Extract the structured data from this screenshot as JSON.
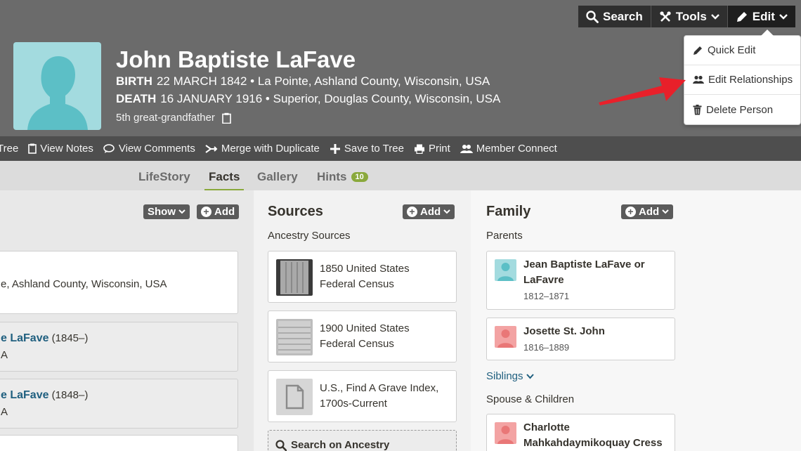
{
  "profile": {
    "name": "John Baptiste LaFave",
    "birth_label": "BIRTH",
    "birth_value": "22 MARCH 1842 • La Pointe, Ashland County, Wisconsin, USA",
    "death_label": "DEATH",
    "death_value": "16 JANUARY 1916 • Superior, Douglas County, Wisconsin, USA",
    "relationship": "5th great-grandfather"
  },
  "top_buttons": {
    "search": "Search",
    "tools": "Tools",
    "edit": "Edit"
  },
  "edit_menu": {
    "quick_edit": "Quick Edit",
    "edit_relationships": "Edit Relationships",
    "delete_person": "Delete Person"
  },
  "action_bar": {
    "tree": "Tree",
    "view_notes": "View Notes",
    "view_comments": "View Comments",
    "merge": "Merge with Duplicate",
    "save": "Save to Tree",
    "print": "Print",
    "member_connect": "Member Connect"
  },
  "tabs": {
    "lifestory": "LifeStory",
    "facts": "Facts",
    "gallery": "Gallery",
    "hints": "Hints",
    "hints_count": "10"
  },
  "facts": {
    "show_label": "Show",
    "add_label": "Add",
    "fact1_place": "e, Ashland County, Wisconsin, USA",
    "sib1_name": "e LaFave",
    "sib1_years": "(1845–)",
    "sib1_sub": "A",
    "sib2_name": "e LaFave",
    "sib2_years": "(1848–)",
    "sib2_sub": "A"
  },
  "sources": {
    "title": "Sources",
    "add_label": "Add",
    "subtitle": "Ancestry Sources",
    "items": [
      {
        "line1": "1850 United States",
        "line2": "Federal Census"
      },
      {
        "line1": "1900 United States",
        "line2": "Federal Census"
      },
      {
        "line1": "U.S., Find A Grave Index,",
        "line2": "1700s-Current"
      }
    ],
    "search_label": "Search on Ancestry"
  },
  "family": {
    "title": "Family",
    "add_label": "Add",
    "parents_label": "Parents",
    "parents": [
      {
        "name": "Jean Baptiste LaFave or LaFavre",
        "years": "1812–1871"
      },
      {
        "name": "Josette St. John",
        "years": "1816–1889"
      }
    ],
    "siblings_label": "Siblings",
    "spouse_label": "Spouse & Children",
    "spouse": {
      "name": "Charlotte Mahkahdaymikoquay Cress"
    }
  },
  "colors": {
    "header_bg": "#6b6b6b",
    "accent_green": "#8aa93c",
    "link_blue": "#1f5f7f",
    "arrow_red": "#e8202a",
    "male_avatar": "#a3dbdf",
    "female_avatar": "#f3a3a3"
  }
}
